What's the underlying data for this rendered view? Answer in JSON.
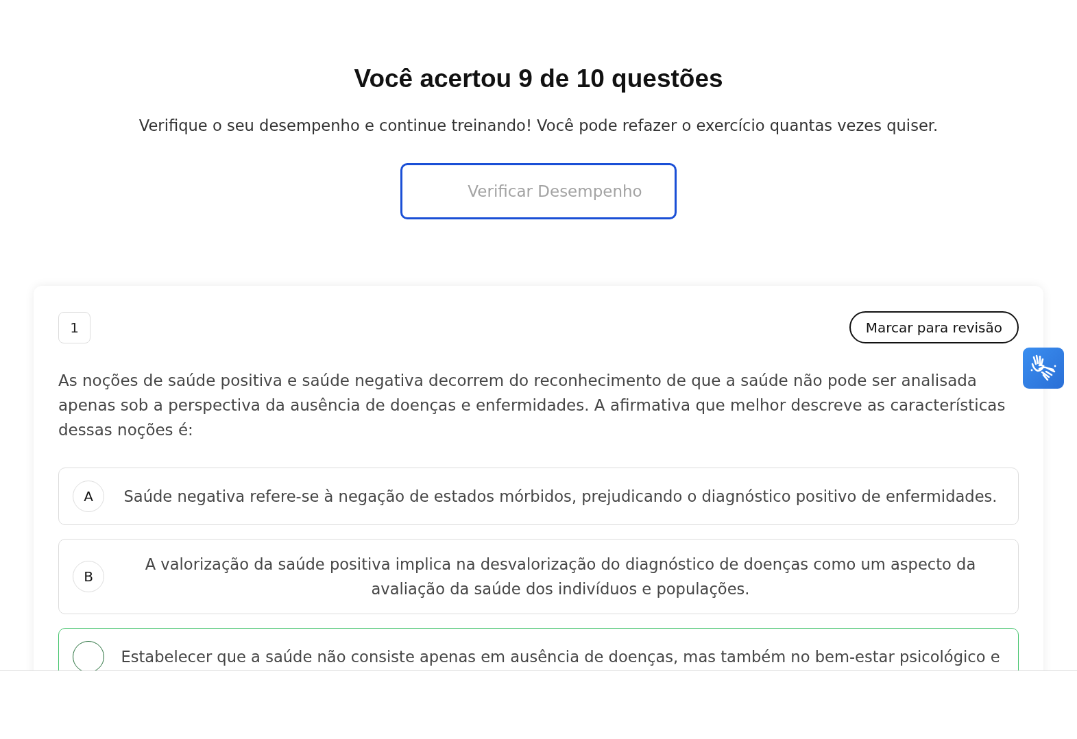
{
  "result": {
    "title": "Você acertou 9 de 10 questões",
    "subtitle": "Verifique o seu desempenho e continue treinando! Você pode refazer o exercício quantas vezes quiser.",
    "button": "Verificar Desempenho"
  },
  "question": {
    "number": "1",
    "review_button": "Marcar para revisão",
    "text": "As noções de saúde positiva e saúde negativa decorrem do reconhecimento de que a saúde não pode ser analisada apenas sob a perspectiva da ausência de doenças e enfermidades. A afirmativa que melhor descreve as características dessas noções é:",
    "options": [
      {
        "letter": "A",
        "text": "Saúde negativa refere-se à negação de estados mórbidos, prejudicando o diagnóstico positivo de enfermidades.",
        "correct": false
      },
      {
        "letter": "B",
        "text": "A valorização da saúde positiva implica na desvalorização do diagnóstico de doenças como um aspecto da avaliação da saúde dos indivíduos e populações.",
        "correct": false
      },
      {
        "text": "Estabelecer que a saúde não consiste apenas em ausência de doenças, mas também no bem-estar psicológico e",
        "correct": true
      }
    ]
  }
}
